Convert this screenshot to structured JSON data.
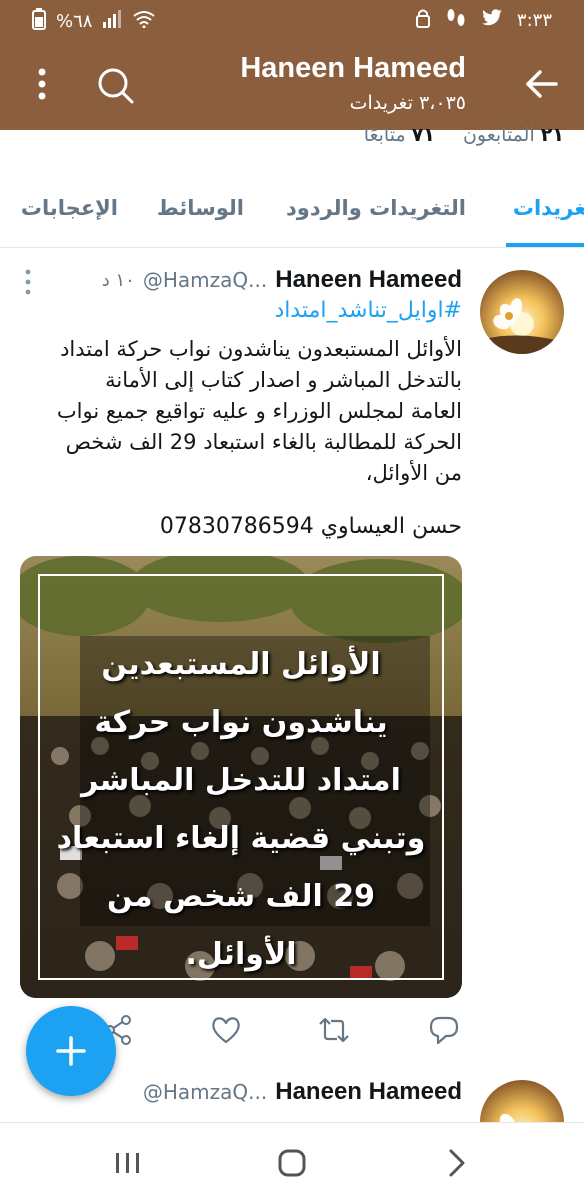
{
  "status_bar": {
    "time": "٣:٣٣",
    "battery": "%٦٨",
    "icons": [
      "twitter-icon",
      "footprints-icon",
      "lock-icon",
      "wifi-icon",
      "signal-icon",
      "battery-icon"
    ]
  },
  "header": {
    "title": "Haneen Hameed",
    "subtitle": "٣،٠٣٥ تغريدات",
    "bg_color": "#8b5f3e"
  },
  "profile": {
    "following_count": "٢١",
    "following_label": "المتابعون",
    "followers_count": "٧١",
    "followers_label": "متابعًا"
  },
  "tabs": [
    {
      "label": "تغريدات",
      "active": true
    },
    {
      "label": "التغريدات والردود",
      "active": false
    },
    {
      "label": "الوسائط",
      "active": false
    },
    {
      "label": "الإعجابات",
      "active": false
    }
  ],
  "tweet": {
    "name": "Haneen Hameed",
    "handle": "@HamzaQ...",
    "time": "١٠ د",
    "hashtag": "#اوايل_تناشد_امتداد",
    "body_lines": [
      "الأوائل المستبعدون يناشدون نواب حركة امتداد",
      "بالتدخل المباشر و اصدار كتاب إلى الأمانة",
      "العامة لمجلس الوزراء و عليه تواقيع جميع نواب",
      "الحركة للمطالبة بالغاء استبعاد 29 الف شخص",
      "من الأوائل،"
    ],
    "signature": "حسن العيساوي 07830786594",
    "media_caption_lines": [
      "الأوائل المستبعدين",
      "يناشدون نواب حركة",
      "امتداد للتدخل المباشر",
      "وتبني قضية إلغاء استبعاد",
      "29 الف شخص من الأوائل."
    ]
  },
  "tweet2": {
    "name": "Haneen Hameed",
    "handle": "@HamzaQ..."
  },
  "accent_color": "#1da1f2"
}
